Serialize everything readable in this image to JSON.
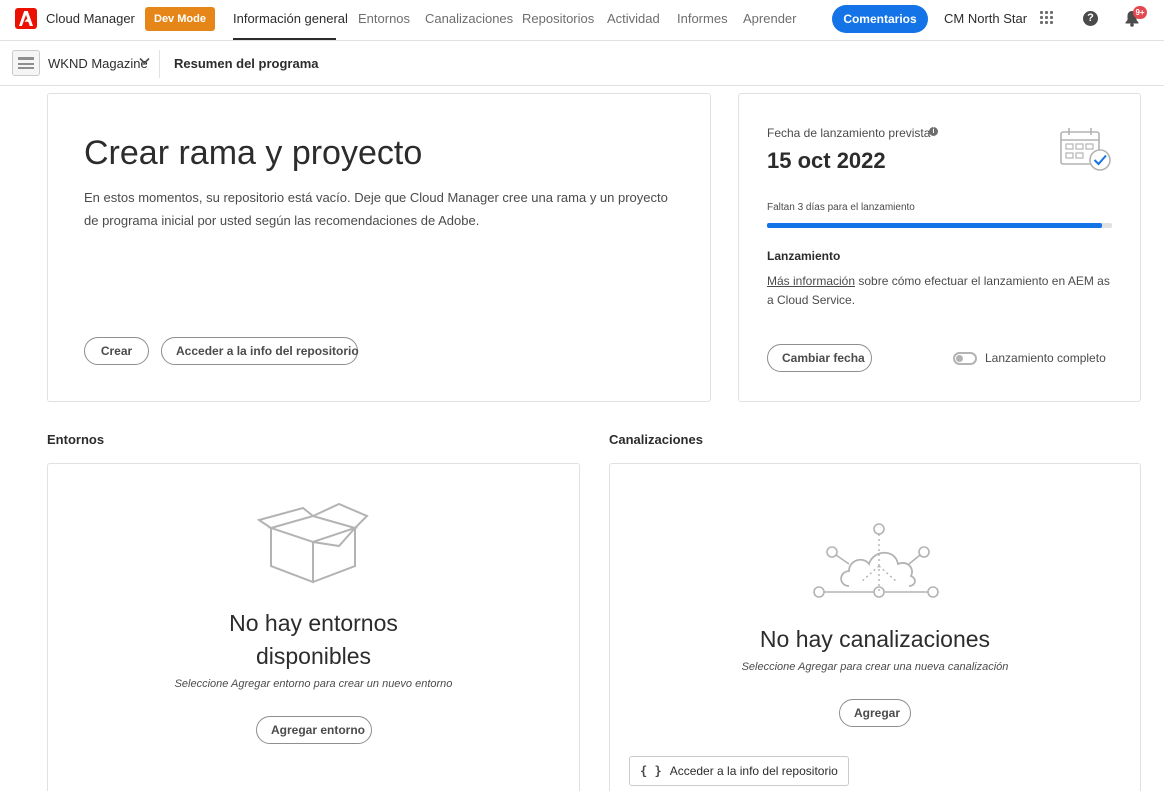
{
  "header": {
    "app_name": "Cloud Manager",
    "dev_mode_badge": "Dev Mode",
    "tabs": [
      {
        "label": "Información general",
        "active": true
      },
      {
        "label": "Entornos",
        "active": false
      },
      {
        "label": "Canalizaciones",
        "active": false
      },
      {
        "label": "Repositorios",
        "active": false
      },
      {
        "label": "Actividad",
        "active": false
      },
      {
        "label": "Informes",
        "active": false
      },
      {
        "label": "Aprender",
        "active": false
      }
    ],
    "feedback_label": "Comentarios",
    "org_name": "CM North Star",
    "help_glyph": "?",
    "notification_badge": "9+"
  },
  "subheader": {
    "program_name": "WKND Magazine",
    "page_title": "Resumen del programa"
  },
  "create_card": {
    "title": "Crear rama y proyecto",
    "description": "En estos momentos, su repositorio está vacío. Deje que Cloud Manager cree una rama y un proyecto de programa inicial por usted según las recomendaciones de Adobe.",
    "create_button": "Crear",
    "repo_info_button": "Acceder a la info del repositorio"
  },
  "launch_card": {
    "label": "Fecha de lanzamiento prevista",
    "info_glyph": "i",
    "date": "15 oct 2022",
    "days_left": "Faltan 3 días para el lanzamiento",
    "progress": 0.97,
    "heading": "Lanzamiento",
    "more_info_link": "Más información",
    "more_info_text": " sobre cómo efectuar el lanzamiento en AEM as a Cloud Service.",
    "change_date_button": "Cambiar fecha",
    "complete_toggle_label": "Lanzamiento completo",
    "complete_toggle_on": false
  },
  "environments": {
    "section_title": "Entornos",
    "empty_title_line1": "No hay entornos",
    "empty_title_line2": "disponibles",
    "empty_subtitle": "Seleccione Agregar entorno para crear un nuevo entorno",
    "add_button": "Agregar entorno"
  },
  "pipelines": {
    "section_title": "Canalizaciones",
    "empty_title": "No hay canalizaciones",
    "empty_subtitle": "Seleccione Agregar para crear una nueva canalización",
    "add_button": "Agregar",
    "repo_button": "Acceder a la info del repositorio",
    "repo_braces": "{ }"
  },
  "colors": {
    "accent": "#1473e6",
    "dev_mode": "#e68619",
    "brand": "#eb1000",
    "badge": "#e34850"
  }
}
